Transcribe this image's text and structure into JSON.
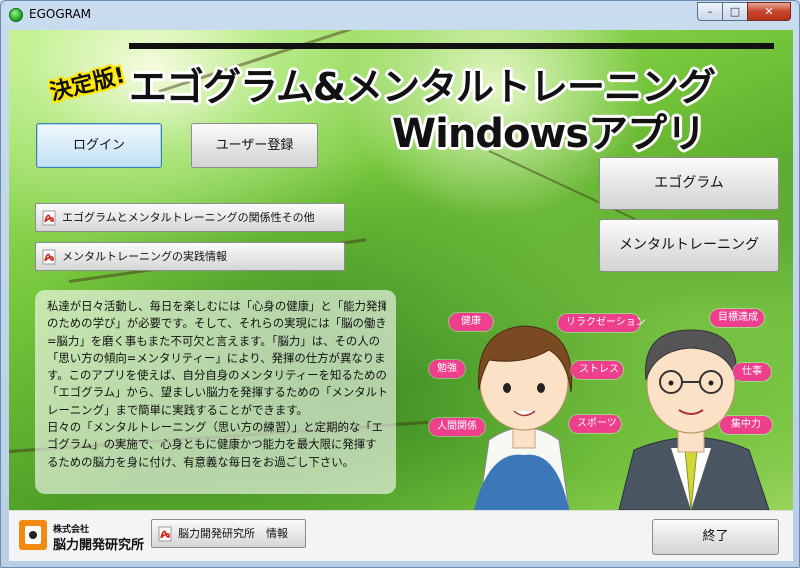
{
  "window": {
    "title": "EGOGRAM",
    "minimize_glyph": "–",
    "maximize_glyph": "□",
    "close_glyph": "✕"
  },
  "banner": {
    "badge": "決定版!",
    "title_line1": "エゴグラム&メンタルトレーニング",
    "title_line2": "Windowsアプリ"
  },
  "buttons": {
    "login": "ログイン",
    "register": "ユーザー登録",
    "egogram": "エゴグラム",
    "mental_training": "メンタルトレーニング",
    "exit": "終了"
  },
  "pdf_links": [
    {
      "label": "エゴグラムとメンタルトレーニングの関係性その他",
      "icon": "pdf-icon"
    },
    {
      "label": "メンタルトレーニングの実践情報",
      "icon": "pdf-icon"
    },
    {
      "label": "脳力開発研究所　情報",
      "icon": "pdf-icon"
    }
  ],
  "info_text": [
    "私達が日々活動し、毎日を楽しむには「心身の健康」と「能力発揮",
    "のための学び」が必要です。そして、それらの実現には「脳の働き",
    "=脳力」を磨く事もまた不可欠と言えます。「脳力」は、その人の",
    "「思い方の傾向=メンタリティー」により、発揮の仕方が異なりま",
    "す。このアプリを使えば、自分自身のメンタリティーを知るための",
    "「エゴグラム」から、望ましい脳力を発揮するための「メンタルト",
    "レーニング」まで簡単に実践することができます。",
    "日々の「メンタルトレーニング（思い方の練習）」と定期的な「エ",
    "ゴグラム」の実施で、心身ともに健康かつ能力を最大限に発揮す",
    "るための脳力を身に付け、有意義な毎日をお過ごし下さい。"
  ],
  "tags": [
    "健康",
    "リラクゼーション",
    "目標達成",
    "勉強",
    "ストレス",
    "仕事",
    "人間関係",
    "スポーツ",
    "集中力"
  ],
  "logo": {
    "small": "株式会社",
    "name": "脳力開発研究所"
  },
  "colors": {
    "tag_bg": "#ee3f8d",
    "badge_outline": "#ffe600",
    "leaf_green": "#78c83d"
  }
}
